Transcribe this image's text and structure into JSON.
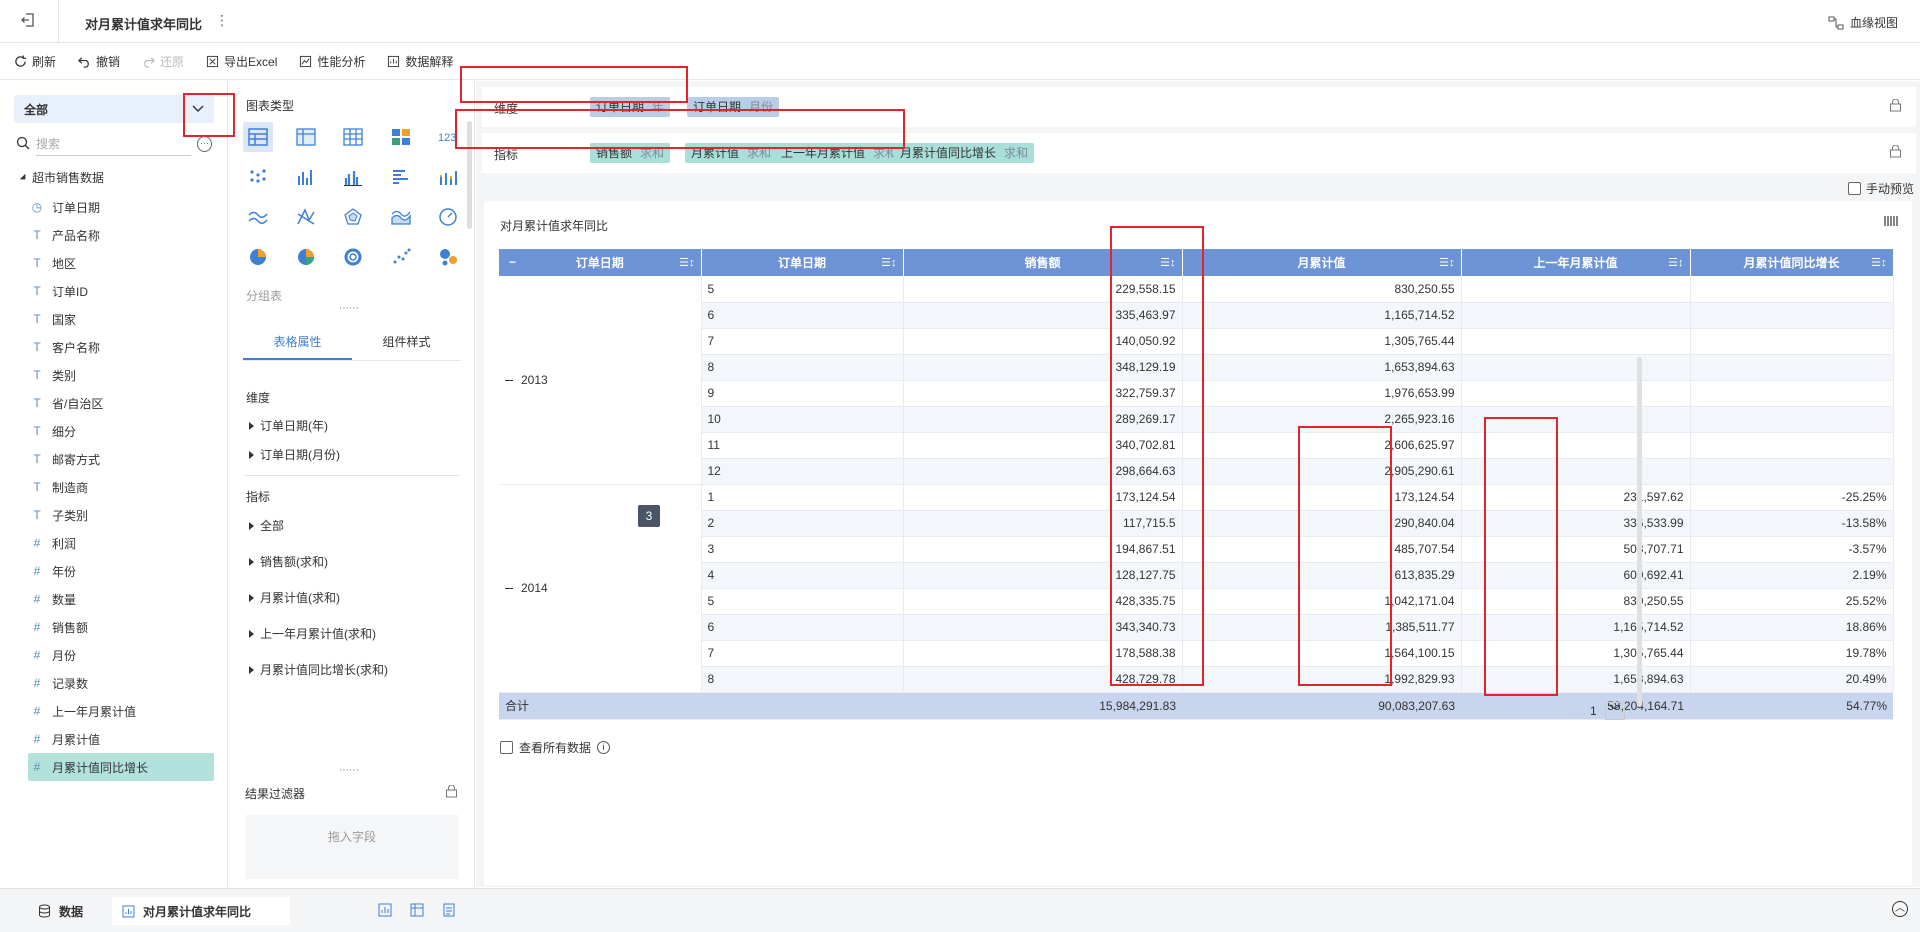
{
  "header": {
    "title": "对月累计值求年同比",
    "lineage_label": "血缘视图"
  },
  "toolbar": {
    "refresh": "刷新",
    "undo": "撤销",
    "redo": "还原",
    "export": "导出Excel",
    "perf": "性能分析",
    "explain": "数据解释"
  },
  "left": {
    "scope": "全部",
    "search_placeholder": "搜索",
    "dataset": "超市销售数据",
    "fields": [
      {
        "icon": "◷",
        "label": "订单日期"
      },
      {
        "icon": "T",
        "label": "产品名称"
      },
      {
        "icon": "T",
        "label": "地区"
      },
      {
        "icon": "T",
        "label": "订单ID"
      },
      {
        "icon": "T",
        "label": "国家"
      },
      {
        "icon": "T",
        "label": "客户名称"
      },
      {
        "icon": "T",
        "label": "类别"
      },
      {
        "icon": "T",
        "label": "省/自治区"
      },
      {
        "icon": "T",
        "label": "细分"
      },
      {
        "icon": "T",
        "label": "邮寄方式"
      },
      {
        "icon": "T",
        "label": "制造商"
      },
      {
        "icon": "T",
        "label": "子类别"
      },
      {
        "icon": "#",
        "label": "利润"
      },
      {
        "icon": "#",
        "label": "年份"
      },
      {
        "icon": "#",
        "label": "数量"
      },
      {
        "icon": "#",
        "label": "销售额"
      },
      {
        "icon": "#",
        "label": "月份"
      },
      {
        "icon": "#",
        "label": "记录数"
      },
      {
        "icon": "#",
        "label": "上一年月累计值"
      },
      {
        "icon": "#",
        "label": "月累计值"
      },
      {
        "icon": "#",
        "label": "月累计值同比增长"
      }
    ]
  },
  "mid": {
    "chart_types_label": "图表类型",
    "chart_type_name": "分组表",
    "tabs": [
      "表格属性",
      "组件样式"
    ],
    "dimension_label": "维度",
    "dimensions": [
      "订单日期(年)",
      "订单日期(月份)"
    ],
    "metric_label": "指标",
    "metrics": [
      "全部",
      "销售额(求和)",
      "月累计值(求和)",
      "上一年月累计值(求和)",
      "月累计值同比增长(求和)"
    ],
    "filter_title": "结果过滤器",
    "filter_drop": "拖入字段"
  },
  "shelf": {
    "dim_label": "维度",
    "dim_pills": [
      {
        "name": "订单日期",
        "agg": "年"
      },
      {
        "name": "订单日期",
        "agg": "月份"
      }
    ],
    "mea_label": "指标",
    "mea_pills": [
      {
        "name": "销售额",
        "agg": "求和"
      },
      {
        "name": "月累计值",
        "agg": "求和"
      },
      {
        "name": "上一年月累计值",
        "agg": "求和"
      },
      {
        "name": "月累计值同比增长",
        "agg": "求和"
      }
    ],
    "manual_preview": "手动预览"
  },
  "table": {
    "title": "对月累计值求年同比",
    "headers": [
      "订单日期",
      "订单日期",
      "销售额",
      "月累计值",
      "上一年月累计值",
      "月累计值同比增长"
    ],
    "groups": [
      {
        "year": "2013",
        "rows": [
          [
            "5",
            "229,558.15",
            "830,250.55",
            "",
            ""
          ],
          [
            "6",
            "335,463.97",
            "1,165,714.52",
            "",
            ""
          ],
          [
            "7",
            "140,050.92",
            "1,305,765.44",
            "",
            ""
          ],
          [
            "8",
            "348,129.19",
            "1,653,894.63",
            "",
            ""
          ],
          [
            "9",
            "322,759.37",
            "1,976,653.99",
            "",
            ""
          ],
          [
            "10",
            "289,269.17",
            "2,265,923.16",
            "",
            ""
          ],
          [
            "11",
            "340,702.81",
            "2,606,625.97",
            "",
            ""
          ],
          [
            "12",
            "298,664.63",
            "2,905,290.61",
            "",
            ""
          ]
        ]
      },
      {
        "year": "2014",
        "rows": [
          [
            "1",
            "173,124.54",
            "173,124.54",
            "231,597.62",
            "-25.25%"
          ],
          [
            "2",
            "117,715.5",
            "290,840.04",
            "336,533.99",
            "-13.58%"
          ],
          [
            "3",
            "194,867.51",
            "485,707.54",
            "503,707.71",
            "-3.57%"
          ],
          [
            "4",
            "128,127.75",
            "613,835.29",
            "600,692.41",
            "2.19%"
          ],
          [
            "5",
            "428,335.75",
            "1,042,171.04",
            "830,250.55",
            "25.52%"
          ],
          [
            "6",
            "343,340.73",
            "1,385,511.77",
            "1,165,714.52",
            "18.86%"
          ],
          [
            "7",
            "178,588.38",
            "1,564,100.15",
            "1,305,765.44",
            "19.78%"
          ],
          [
            "8",
            "428,729.78",
            "1,992,829.93",
            "1,653,894.63",
            "20.49%"
          ]
        ]
      }
    ],
    "total": [
      "合计",
      "15,984,291.83",
      "90,083,207.63",
      "58,204,164.71",
      "54.77%"
    ],
    "tooltip": "3",
    "page": "1",
    "view_all": "查看所有数据"
  },
  "bottom": {
    "data_tab": "数据",
    "sheet_tab": "对月累计值求年同比"
  },
  "colors": {
    "header": "#6b93d6",
    "accent": "#3e7fd6",
    "highlight": "#e0262a",
    "dim_pill": "#b7cde9",
    "mea_pill": "#a9dfd8"
  }
}
